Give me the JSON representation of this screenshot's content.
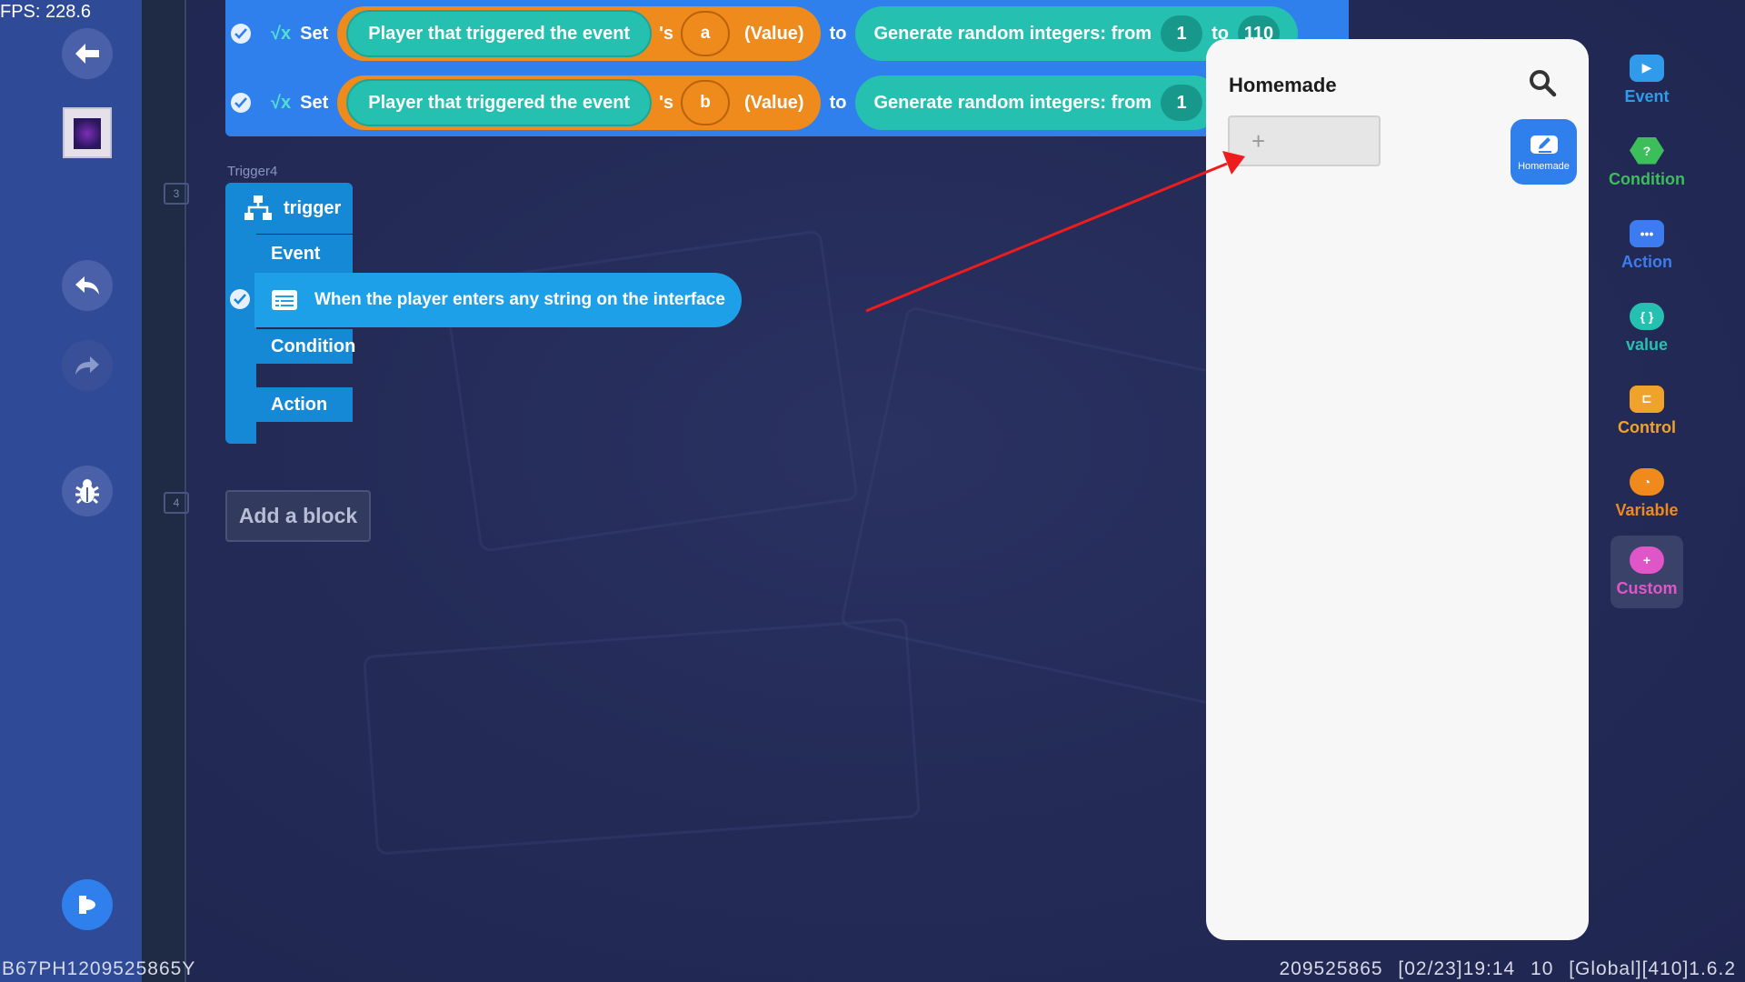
{
  "fps": "FPS: 228.6",
  "rows": [
    {
      "set_label": "Set",
      "player": "Player that triggered the event",
      "apos": "'s",
      "var": "a",
      "value_label": "(Value)",
      "to_label": "to",
      "rand_label": "Generate random integers: from",
      "from_num": "1",
      "to_label2": "to",
      "to_num": "110"
    },
    {
      "set_label": "Set",
      "player": "Player that triggered the event",
      "apos": "'s",
      "var": "b",
      "value_label": "(Value)",
      "to_label": "to",
      "rand_label": "Generate random integers: from",
      "from_num": "1"
    }
  ],
  "line_numbers": {
    "trigger": "3",
    "add": "4"
  },
  "trigger": {
    "name_label": "Trigger4",
    "title": "trigger",
    "event_label": "Event",
    "event_text": "When the player enters any string on the interface",
    "condition_label": "Condition",
    "action_label": "Action"
  },
  "add_block_label": "Add a block",
  "panel": {
    "title": "Homemade",
    "new_block_plus": "+",
    "tab_label": "Homemade"
  },
  "categories": [
    {
      "label": "Event",
      "color": "#2f9bea"
    },
    {
      "label": "Condition",
      "color": "#3cbf5a"
    },
    {
      "label": "Action",
      "color": "#3d7cf0"
    },
    {
      "label": "value",
      "color": "#26c0b0"
    },
    {
      "label": "Control",
      "color": "#f0a32a"
    },
    {
      "label": "Variable",
      "color": "#f08a1c"
    },
    {
      "label": "Custom",
      "color": "#e056c8"
    }
  ],
  "footer": {
    "left": "B67PH1209525865Y",
    "right": "209525865 [02/23]19:14 10 [Global][410]1.6.2"
  }
}
